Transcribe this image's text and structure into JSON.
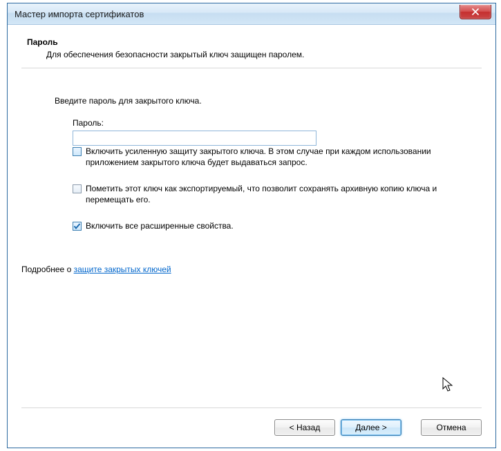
{
  "window": {
    "title": "Мастер импорта сертификатов"
  },
  "header": {
    "section": "Пароль",
    "description": "Для обеспечения безопасности закрытый ключ защищен паролем."
  },
  "body": {
    "instruction": "Введите пароль для закрытого ключа.",
    "password_label": "Пароль:",
    "password_value": "",
    "options": [
      {
        "checked": false,
        "highlight": true,
        "text": "Включить усиленную защиту закрытого ключа. В этом случае при каждом использовании приложением закрытого ключа будет выдаваться запрос."
      },
      {
        "checked": false,
        "highlight": false,
        "text": "Пометить этот ключ как экспортируемый, что позволит сохранять архивную копию ключа и перемещать его."
      },
      {
        "checked": true,
        "highlight": true,
        "text": "Включить все расширенные свойства."
      }
    ],
    "learn_more_prefix": "Подробнее о ",
    "learn_more_link": "защите закрытых ключей"
  },
  "buttons": {
    "back": "< Назад",
    "next": "Далее >",
    "cancel": "Отмена"
  }
}
